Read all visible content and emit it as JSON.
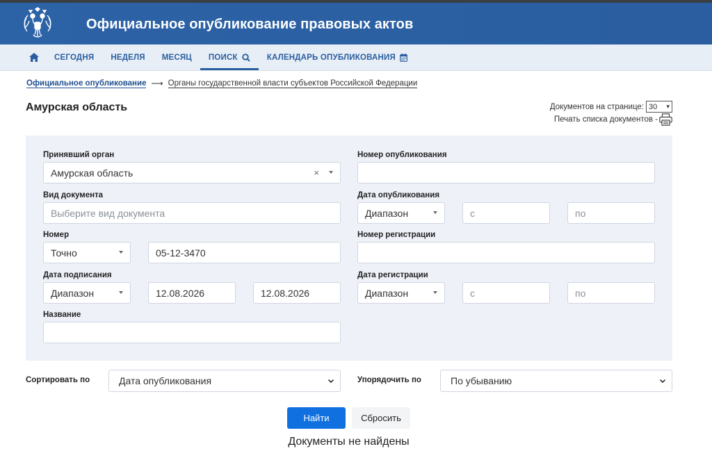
{
  "header": {
    "title": "Официальное опубликование правовых актов"
  },
  "nav": {
    "items": [
      {
        "label": "Сегодня"
      },
      {
        "label": "Неделя"
      },
      {
        "label": "Месяц"
      },
      {
        "label": "Поиск"
      },
      {
        "label": "Календарь опубликования"
      }
    ],
    "active": "Поиск"
  },
  "breadcrumb": {
    "root": "Официальное опубликование",
    "current": "Органы государственной власти субъектов Российской Федерации"
  },
  "page_title": "Амурская область",
  "perpage": {
    "label": "Документов на странице:",
    "value": "30"
  },
  "print_label": "Печать списка документов -",
  "form": {
    "organ": {
      "label": "Принявший орган",
      "value": "Амурская область"
    },
    "doc_type": {
      "label": "Вид документа",
      "placeholder": "Выберите вид документа"
    },
    "number": {
      "label": "Номер",
      "mode": "Точно",
      "value": "05-12-3470"
    },
    "sign_date": {
      "label": "Дата подписания",
      "mode": "Диапазон",
      "from": "12.08.2026",
      "to": "12.08.2026"
    },
    "name": {
      "label": "Название",
      "value": ""
    },
    "pub_number": {
      "label": "Номер опубликования",
      "value": ""
    },
    "pub_date": {
      "label": "Дата опубликования",
      "mode": "Диапазон",
      "from_placeholder": "с",
      "to_placeholder": "по"
    },
    "reg_number": {
      "label": "Номер регистрации",
      "value": ""
    },
    "reg_date": {
      "label": "Дата регистрации",
      "mode": "Диапазон",
      "from_placeholder": "с",
      "to_placeholder": "по"
    }
  },
  "sort": {
    "label": "Сортировать по",
    "value": "Дата опубликования",
    "order_label": "Упорядочить по",
    "order_value": "По убыванию"
  },
  "buttons": {
    "find": "Найти",
    "reset": "Сбросить"
  },
  "result_message": "Документы не найдены",
  "colors": {
    "header": "#2a5ea0",
    "nav_bg": "#e8eef6",
    "panel_bg": "#eef1f8",
    "primary_button": "#1170e0"
  }
}
